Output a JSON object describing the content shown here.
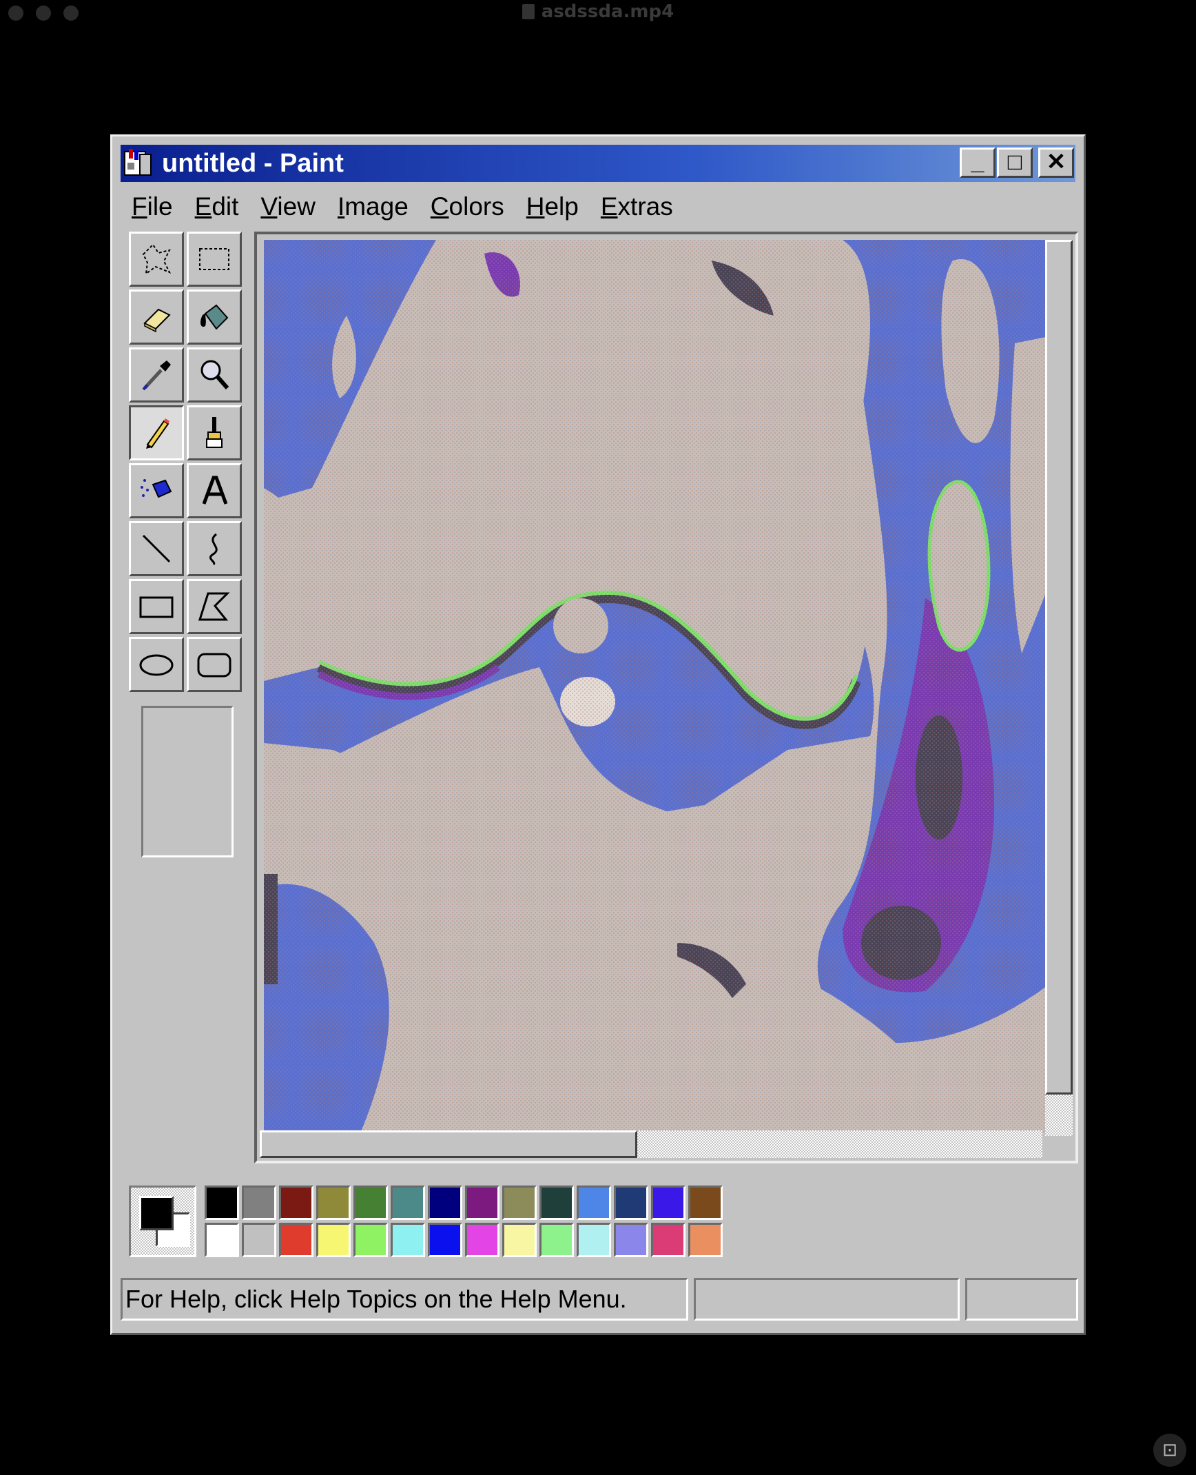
{
  "host": {
    "title": "asdssda.mp4"
  },
  "window": {
    "title": "untitled - Paint",
    "controls": {
      "minimize": "_",
      "maximize": "□",
      "close": "✕"
    }
  },
  "menu": [
    {
      "label": "File"
    },
    {
      "label": "Edit"
    },
    {
      "label": "View"
    },
    {
      "label": "Image"
    },
    {
      "label": "Colors"
    },
    {
      "label": "Help"
    },
    {
      "label": "Extras"
    }
  ],
  "tools": [
    {
      "name": "free-form-select-icon"
    },
    {
      "name": "select-icon"
    },
    {
      "name": "eraser-icon"
    },
    {
      "name": "fill-bucket-icon"
    },
    {
      "name": "color-picker-icon"
    },
    {
      "name": "magnifier-icon"
    },
    {
      "name": "pencil-icon",
      "active": true
    },
    {
      "name": "brush-icon"
    },
    {
      "name": "airbrush-icon"
    },
    {
      "name": "text-icon"
    },
    {
      "name": "line-icon"
    },
    {
      "name": "curve-icon"
    },
    {
      "name": "rectangle-icon"
    },
    {
      "name": "polygon-icon"
    },
    {
      "name": "ellipse-icon"
    },
    {
      "name": "rounded-rectangle-icon"
    }
  ],
  "palette": {
    "foreground": "#000000",
    "background": "#ffffff",
    "top_row": [
      "#000000",
      "#808080",
      "#7b1a12",
      "#8f8a3a",
      "#468032",
      "#4c8a8a",
      "#00007f",
      "#7d1a7f",
      "#8b8c5a",
      "#1f3f3a",
      "#4d86e6",
      "#1f3a74",
      "#3a18e8",
      "#7b4a1c"
    ],
    "bottom_row": [
      "#ffffff",
      "#c0c0c0",
      "#e03c2e",
      "#f6f672",
      "#8ef262",
      "#8ef0f0",
      "#0a10ee",
      "#e244e6",
      "#f8f6a2",
      "#8ef28c",
      "#b0f0f0",
      "#8a86ea",
      "#dc3c76",
      "#ea9060"
    ]
  },
  "canvas": {
    "colors": {
      "bone": "#c8bcb6",
      "blue": "#5b6fcf",
      "purple": "#7a3ab0",
      "dark": "#4a4456",
      "green": "#7fe36a"
    }
  },
  "status": {
    "help_text": "For Help, click Help Topics on the Help Menu.",
    "coords": "",
    "size": ""
  }
}
